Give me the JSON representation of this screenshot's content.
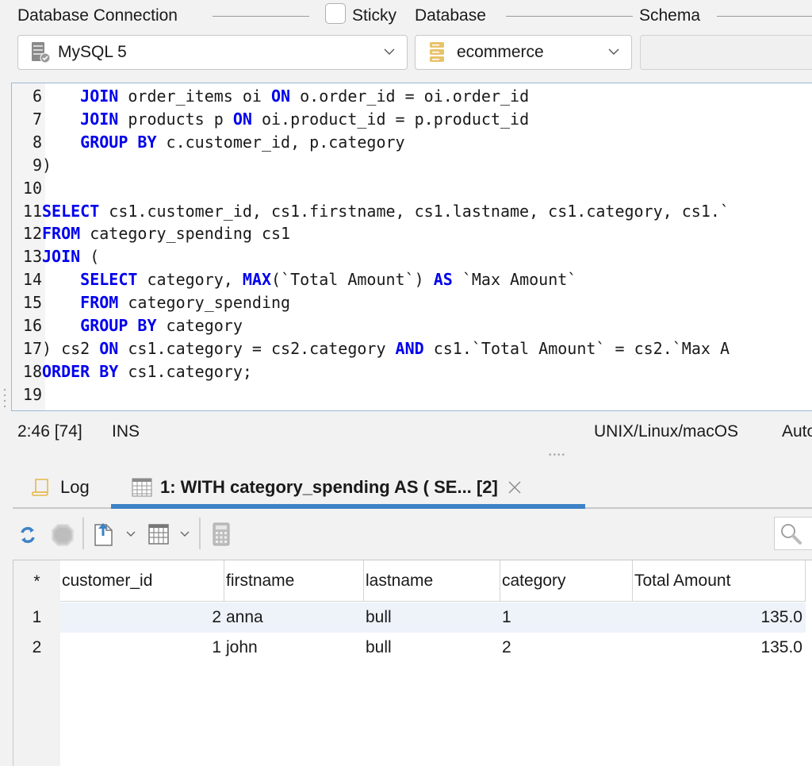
{
  "header": {
    "connection_label": "Database Connection",
    "sticky_label": "Sticky",
    "sticky_checked": false,
    "database_label": "Database",
    "schema_label": "Schema",
    "connection_value": "MySQL 5",
    "database_value": "ecommerce",
    "schema_value": ""
  },
  "editor": {
    "lines": [
      {
        "n": "6",
        "tokens": [
          [
            "txt",
            "    "
          ],
          [
            "kw",
            "JOIN"
          ],
          [
            "txt",
            " order_items oi "
          ],
          [
            "kw",
            "ON"
          ],
          [
            "txt",
            " o.order_id = oi.order_id"
          ]
        ]
      },
      {
        "n": "7",
        "tokens": [
          [
            "txt",
            "    "
          ],
          [
            "kw",
            "JOIN"
          ],
          [
            "txt",
            " products p "
          ],
          [
            "kw",
            "ON"
          ],
          [
            "txt",
            " oi.product_id = p.product_id"
          ]
        ]
      },
      {
        "n": "8",
        "tokens": [
          [
            "txt",
            "    "
          ],
          [
            "kw",
            "GROUP BY"
          ],
          [
            "txt",
            " c.customer_id, p.category"
          ]
        ]
      },
      {
        "n": "9",
        "tokens": [
          [
            "txt",
            ")"
          ]
        ]
      },
      {
        "n": "10",
        "tokens": []
      },
      {
        "n": "11",
        "tokens": [
          [
            "kw",
            "SELECT"
          ],
          [
            "txt",
            " cs1.customer_id, cs1.firstname, cs1.lastname, cs1.category, cs1.`"
          ]
        ]
      },
      {
        "n": "12",
        "tokens": [
          [
            "kw",
            "FROM"
          ],
          [
            "txt",
            " category_spending cs1"
          ]
        ]
      },
      {
        "n": "13",
        "tokens": [
          [
            "kw",
            "JOIN"
          ],
          [
            "txt",
            " ("
          ]
        ]
      },
      {
        "n": "14",
        "tokens": [
          [
            "txt",
            "    "
          ],
          [
            "kw",
            "SELECT"
          ],
          [
            "txt",
            " category, "
          ],
          [
            "kw",
            "MAX"
          ],
          [
            "txt",
            "(`Total Amount`) "
          ],
          [
            "kw",
            "AS"
          ],
          [
            "txt",
            " `Max Amount`"
          ]
        ]
      },
      {
        "n": "15",
        "tokens": [
          [
            "txt",
            "    "
          ],
          [
            "kw",
            "FROM"
          ],
          [
            "txt",
            " category_spending"
          ]
        ]
      },
      {
        "n": "16",
        "tokens": [
          [
            "txt",
            "    "
          ],
          [
            "kw",
            "GROUP BY"
          ],
          [
            "txt",
            " category"
          ]
        ]
      },
      {
        "n": "17",
        "tokens": [
          [
            "txt",
            ") cs2 "
          ],
          [
            "kw",
            "ON"
          ],
          [
            "txt",
            " cs1.category = cs2.category "
          ],
          [
            "kw",
            "AND"
          ],
          [
            "txt",
            " cs1.`Total Amount` = cs2.`Max A"
          ]
        ]
      },
      {
        "n": "18",
        "tokens": [
          [
            "kw",
            "ORDER BY"
          ],
          [
            "txt",
            " cs1.category;"
          ]
        ]
      },
      {
        "n": "19",
        "tokens": []
      }
    ]
  },
  "status": {
    "cursor": "2:46 [74]",
    "mode": "INS",
    "line_endings": "UNIX/Linux/macOS",
    "extra": "Auto"
  },
  "tabs": [
    {
      "label": "Log",
      "icon": "scroll-icon",
      "active": false
    },
    {
      "label": "1: WITH category_spending AS ( SE... [2]",
      "icon": "grid-icon",
      "active": true,
      "closable": true
    }
  ],
  "toolbar": {
    "icons": [
      "refresh-icon",
      "stop-icon",
      "export-icon",
      "grid-layout-icon",
      "calculator-icon",
      "search-icon"
    ]
  },
  "results": {
    "corner": "*",
    "columns": [
      "customer_id",
      "firstname",
      "lastname",
      "category",
      "Total Amount"
    ],
    "rows": [
      {
        "num": "1",
        "cells": [
          "2",
          "anna",
          "bull",
          "1",
          "135.0"
        ]
      },
      {
        "num": "2",
        "cells": [
          "1",
          "john",
          "bull",
          "2",
          "135.0"
        ]
      }
    ]
  },
  "colors": {
    "keyword": "#0000ee",
    "accent": "#3d82c6",
    "selected_row": "#eef3fa"
  }
}
